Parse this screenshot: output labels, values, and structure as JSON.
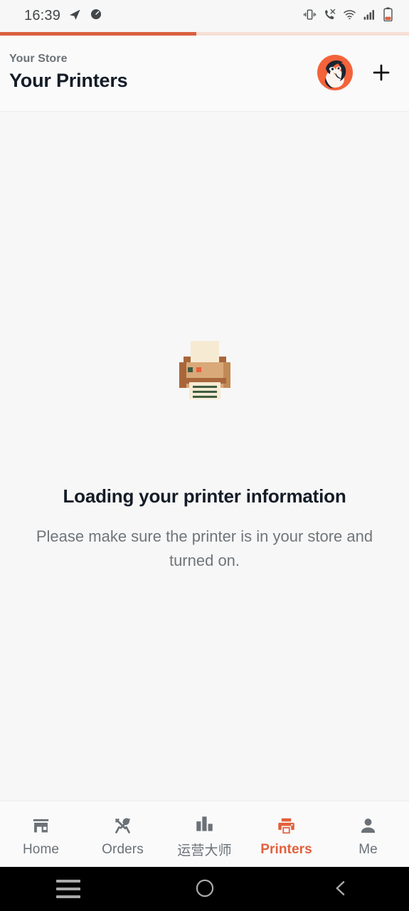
{
  "statusbar": {
    "time": "16:39",
    "left_icons": [
      "telegram-plane-icon",
      "speedometer-icon"
    ],
    "right_icons": [
      "vibrate-icon",
      "missed-call-icon",
      "wifi-icon",
      "cell-signal-icon",
      "battery-low-icon"
    ]
  },
  "progress": {
    "percent": 48,
    "fill_color": "#d9603f",
    "track_color": "#f6dfd6"
  },
  "appbar": {
    "store_label": "Your Store",
    "title": "Your Printers",
    "avatar_name": "user-avatar",
    "add_label": "+"
  },
  "empty_state": {
    "illustration": "printer-emoji",
    "title": "Loading your printer information",
    "subtitle": "Please make sure the printer is in your store and turned on."
  },
  "tabbar": {
    "active_color": "#e2603c",
    "inactive_color": "#6b7177",
    "items": [
      {
        "label": "Home",
        "icon": "storefront-icon",
        "active": false
      },
      {
        "label": "Orders",
        "icon": "cutlery-icon",
        "active": false
      },
      {
        "label": "运营大师",
        "icon": "bar-chart-icon",
        "active": false
      },
      {
        "label": "Printers",
        "icon": "printer-icon",
        "active": true
      },
      {
        "label": "Me",
        "icon": "person-icon",
        "active": false
      }
    ]
  },
  "sysnav": {
    "recents": "recents-button",
    "home": "home-button",
    "back": "back-button"
  }
}
